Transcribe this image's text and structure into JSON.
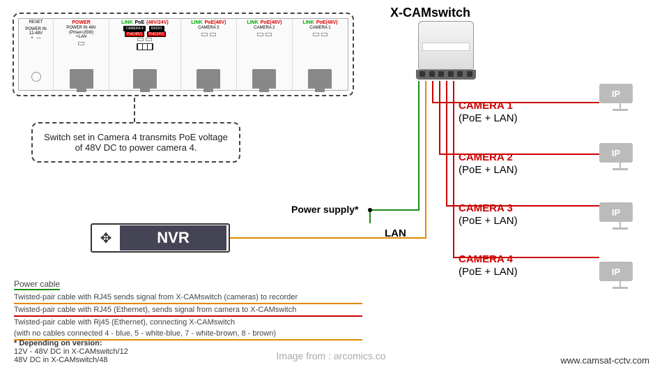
{
  "title": "X-CAMswitch",
  "switch_panel": {
    "col0": {
      "reset": "RESET",
      "sub": "POWER IN\n12-48V\n+   —"
    },
    "col1": {
      "l1": "POWER",
      "sub": "POWER IN 48V\n(Pmax<25W)\n+LAN"
    },
    "col2": {
      "l1": "LINK",
      "l2": "PoE",
      "voltage": "(48V/24V)",
      "chip1": "CAMERA 4",
      "chip1b": "PoE(48V)",
      "chip2": "RADIO",
      "chip2b": "PoE(24V)"
    },
    "col3": {
      "l1": "LINK",
      "l2": "PoE(48V)",
      "name": "CAMERA 3"
    },
    "col4": {
      "l1": "LINK",
      "l2": "PoE(48V)",
      "name": "CAMERA 2"
    },
    "col5": {
      "l1": "LINK",
      "l2": "PoE(48V)",
      "name": "CAMERA 1"
    }
  },
  "callout": "Switch set in Camera 4 transmits PoE voltage of 48V DC to power camera 4.",
  "nvr": "NVR",
  "power_supply": "Power supply*",
  "lan": "LAN",
  "cameras": {
    "c1": {
      "name": "CAMERA 1",
      "sub": "(PoE + LAN)"
    },
    "c2": {
      "name": "CAMERA 2",
      "sub": "(PoE + LAN)"
    },
    "c3": {
      "name": "CAMERA 3",
      "sub": "(PoE + LAN)"
    },
    "c4": {
      "name": "CAMERA 4",
      "sub": "(PoE + LAN)"
    }
  },
  "ip_label": "IP",
  "legend": {
    "title": "Power cable",
    "line1": "Twisted-pair cable with RJ45 sends signal from X-CAMswitch (cameras) to recorder",
    "line2": "Twisted-pair cable with RJ45 (Ethernet), sends signal from camera to X-CAMswitch",
    "line3a": "Twisted-pair cable with Rj45 (Ethernet), connecting X-CAMswitch",
    "line3b": "(with no cables connected 4 - blue, 5 - white-blue, 7 - white-brown, 8 - brown)"
  },
  "footnote": {
    "title": "* Depending on version:",
    "v1": "12V - 48V DC in X-CAMswitch/12",
    "v2": "48V DC in X-CAMswitch/48"
  },
  "watermark": "Image from : arcomics.co",
  "website": "www.camsat-cctv.com"
}
